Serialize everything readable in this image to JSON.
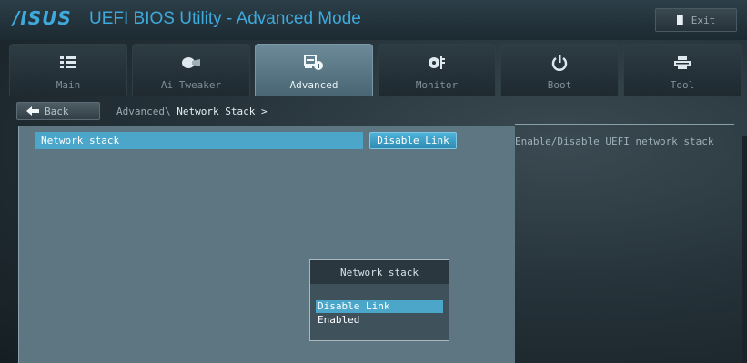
{
  "header": {
    "logo_text": "/ISUS",
    "title": "UEFI BIOS Utility - Advanced Mode",
    "exit_label": "Exit"
  },
  "tabs": [
    {
      "label": "Main",
      "icon": "list-icon",
      "active": false
    },
    {
      "label": "Ai Tweaker",
      "icon": "tweaker-icon",
      "active": false
    },
    {
      "label": "Advanced",
      "icon": "advanced-info-icon",
      "active": true
    },
    {
      "label": "Monitor",
      "icon": "monitor-fan-icon",
      "active": false
    },
    {
      "label": "Boot",
      "icon": "power-icon",
      "active": false
    },
    {
      "label": "Tool",
      "icon": "printer-tool-icon",
      "active": false
    }
  ],
  "nav": {
    "back_label": "Back",
    "breadcrumb_path": "Advanced\\ ",
    "breadcrumb_current": "Network Stack >"
  },
  "settings": {
    "network_stack_label": "Network stack",
    "network_stack_value": "Disable Link"
  },
  "popup": {
    "title": "Network stack",
    "options": [
      "Disable Link",
      "Enabled"
    ],
    "selected_index": 0
  },
  "help": {
    "text": "Enable/Disable UEFI network stack"
  },
  "colors": {
    "accent": "#4ba6c9",
    "title_blue": "#3fa9db",
    "panel": "#5d7682"
  }
}
